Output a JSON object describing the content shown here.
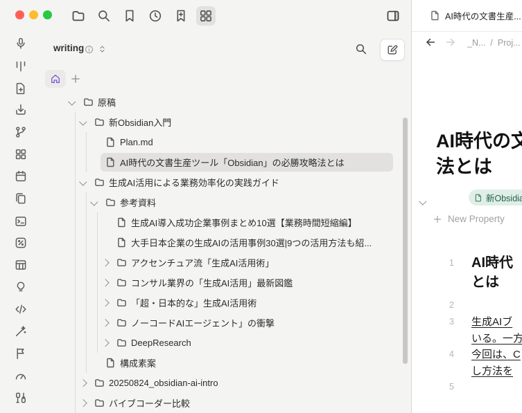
{
  "window": {
    "controls": [
      "close",
      "minimize",
      "zoom"
    ]
  },
  "toolbar": {
    "icons": [
      "folder",
      "search",
      "bookmark",
      "history",
      "bookmark-plus",
      "layout-grid"
    ],
    "active_icon": "layout-grid",
    "right_icon": "panel-right"
  },
  "ribbon": {
    "icons": [
      "microphone",
      "kanban",
      "file-plus",
      "import",
      "git-branch",
      "layout-grid",
      "calendar",
      "files",
      "terminal",
      "percent-badge",
      "table",
      "lightbulb",
      "code",
      "wand",
      "flag",
      "gauge",
      "binary"
    ]
  },
  "sidebar": {
    "header": {
      "vault_name": "writing"
    },
    "actions": {
      "home": "home",
      "add": "+"
    },
    "explorer": {
      "rows": [
        {
          "label": "原稿",
          "type": "folder",
          "state": "expanded",
          "level": 0
        },
        {
          "label": "新Obsidian入門",
          "type": "folder",
          "state": "expanded",
          "level": 1
        },
        {
          "label": "Plan.md",
          "type": "file",
          "level": 2
        },
        {
          "label": "AI時代の文書生産ツール「Obsidian」の必勝攻略法とは",
          "type": "file",
          "level": 2,
          "selected": true
        },
        {
          "label": "生成AI活用による業務効率化の実践ガイド",
          "type": "folder",
          "state": "expanded",
          "level": 1
        },
        {
          "label": "参考資料",
          "type": "folder",
          "state": "expanded",
          "level": 2
        },
        {
          "label": "生成AI導入成功企業事例まとめ10選【業務時間短縮編】",
          "type": "file",
          "level": 3
        },
        {
          "label": "大手日本企業の生成AIの活用事例30選|9つの活用方法も紹...",
          "type": "file",
          "level": 3
        },
        {
          "label": "アクセンチュア流「生成AI活用術」",
          "type": "folder",
          "state": "collapsed",
          "level": 3
        },
        {
          "label": "コンサル業界の「生成AI活用」最新図鑑",
          "type": "folder",
          "state": "collapsed",
          "level": 3
        },
        {
          "label": "「超・日本的な」生成AI活用術",
          "type": "folder",
          "state": "collapsed",
          "level": 3
        },
        {
          "label": "ノーコードAIエージェント」の衝撃",
          "type": "folder",
          "state": "collapsed",
          "level": 3
        },
        {
          "label": "DeepResearch",
          "type": "folder",
          "state": "collapsed",
          "level": 3
        },
        {
          "label": "構成素案",
          "type": "file",
          "level": 2
        },
        {
          "label": "20250824_obsidian-ai-intro",
          "type": "folder",
          "state": "collapsed",
          "level": 1
        },
        {
          "label": "バイブコーダー比較",
          "type": "folder",
          "state": "collapsed",
          "level": 1
        }
      ]
    }
  },
  "editor": {
    "tab": {
      "title": "AI時代の文書生産...",
      "icon": "file"
    },
    "nav": {
      "back_icon": "arrow-left",
      "forward_icon": "arrow-right",
      "breadcrumb": {
        "seg1": "_N...",
        "sep": "/",
        "seg2": "Proj..."
      }
    },
    "title": {
      "line1": "AI時代の文",
      "line2": "法とは"
    },
    "properties": {
      "collapse_icon": "chevron-down",
      "tag": "新Obsidian入門",
      "add_label": "New Property"
    },
    "body": {
      "lines": [
        {
          "num": "1",
          "style": "heading",
          "l1": "AI時代",
          "l2": "とは"
        },
        {
          "num": "2",
          "style": "empty",
          "l1": "",
          "l2": ""
        },
        {
          "num": "3",
          "style": "paragraph",
          "l1": "生成AIブ",
          "l2": "いる。一方"
        },
        {
          "num": "4",
          "style": "paragraph",
          "l1": "今回は、C",
          "l2": "し方法を"
        },
        {
          "num": "5",
          "style": "empty",
          "l1": "",
          "l2": ""
        }
      ]
    }
  },
  "colors": {
    "accent_purple": "#7b5bd6",
    "tag_bg": "#dfeee6",
    "tag_text": "#20604a",
    "selection": "#e2e1df",
    "pane_bg": "#ffffff",
    "app_bg": "#f4f4f3"
  }
}
